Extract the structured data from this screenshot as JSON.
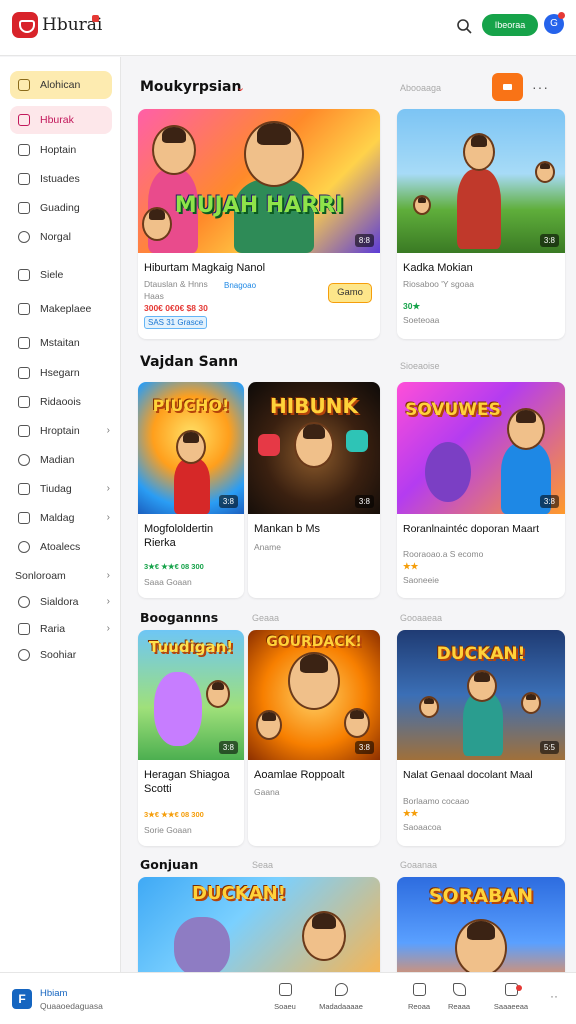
{
  "header": {
    "brand": "Hburai",
    "primary_button": "Ibeoraa",
    "avatar_letter": "G"
  },
  "sidebar": {
    "items": [
      {
        "label": "Alohican",
        "state": "active",
        "icon": "store-icon"
      },
      {
        "label": "Hburak",
        "state": "highlight",
        "icon": "grid-icon"
      },
      {
        "label": "Hoptain",
        "icon": "home-icon"
      },
      {
        "label": "Istuades",
        "icon": "calendar-icon"
      },
      {
        "label": "Guading",
        "icon": "bag-icon"
      },
      {
        "label": "Norgal",
        "icon": "globe-icon"
      },
      {
        "label": "Siele",
        "icon": "chat-icon"
      },
      {
        "label": "Makeplaee",
        "icon": "shop-icon"
      },
      {
        "label": "Mstaitan",
        "icon": "chat-icon"
      },
      {
        "label": "Hsegarn",
        "icon": "calendar-icon"
      },
      {
        "label": "Ridaoois",
        "icon": "grid-icon"
      },
      {
        "label": "Hroptain",
        "icon": "home-icon",
        "chevron": true
      },
      {
        "label": "Madian",
        "icon": "bell-icon"
      },
      {
        "label": "Tiudag",
        "icon": "calendar-icon",
        "chevron": true
      },
      {
        "label": "Maldag",
        "icon": "bag-icon",
        "chevron": true
      },
      {
        "label": "Atoalecs",
        "icon": "chat-icon"
      },
      {
        "label": "Sonloroam",
        "icon": "none",
        "chevron": true
      },
      {
        "label": "Sialdora",
        "icon": "gear-icon",
        "chevron": true
      },
      {
        "label": "Raria",
        "icon": "edit-icon",
        "chevron": true
      },
      {
        "label": "Soohiar",
        "icon": "gear-icon"
      }
    ]
  },
  "main": {
    "sections": [
      {
        "title": "Moukyrpsian",
        "link": "Abooaaga"
      },
      {
        "title": "Vajdan Sann",
        "link": "Sioeaoise"
      },
      {
        "title": "Boogannns",
        "link": "Geaaa",
        "link2": "Gooaaeaa"
      },
      {
        "title": "Gonjuan",
        "link": "Seaa",
        "link2": "Goaanaa"
      }
    ],
    "cards": [
      {
        "title": "Hiburtam Magkaig Nanol",
        "sub1": "Dtauslan & Hnns",
        "sub2": "Haas",
        "sub_link": "Bnagoao",
        "price": "300€ 0€0€ $8 30",
        "tag": "SAS 31 Grasce",
        "button": "Gamo",
        "badge": "8:8",
        "art": "MUJAH HARRI"
      },
      {
        "title": "Kadka Mokian",
        "sub1": "Riosaboo 'Y sgoaa",
        "rating": "30★",
        "sub2": "Soeteoaa",
        "badge": "3:8"
      },
      {
        "title": "Mogfololdertin Rierka",
        "rating": "3★€ ★★€ 08 300",
        "sub2": "Saaa Goaan",
        "badge": "3:8",
        "art": "PIUCHO!"
      },
      {
        "title": "Mankan b Ms",
        "sub1": "Aname",
        "badge": "3:8",
        "art": "HIBUNK"
      },
      {
        "title": "Roranlnaintéc doporan Maart",
        "sub1": "Rooraoao.a S ecomo",
        "rating": "★★",
        "sub2": "Saoneeie",
        "badge": "3:8",
        "art": "SOVUWES"
      },
      {
        "title": "Heragan Shiagoa Scotti",
        "rating": "3★€ ★★€ 08 300",
        "sub2": "Sorie Goaan",
        "badge": "3:8",
        "art": "Tuudigan!"
      },
      {
        "title": "Aoamlae Roppoalt",
        "sub1": "Gaana",
        "badge": "3:8",
        "art": "GOURDACK!"
      },
      {
        "title": "Nalat Genaal docolant Maal",
        "sub1": "Borlaamo cocaao",
        "rating": "★★",
        "sub2": "Saoaacoa",
        "badge": "5:5",
        "art": "DUCKAN!"
      },
      {
        "title": "",
        "art": "DUCKAN!"
      },
      {
        "title": "",
        "art": "SORABAN"
      }
    ]
  },
  "bottombar": {
    "app_title": "Hbiam",
    "app_sub": "Quaaoedaguasa",
    "tabs": [
      {
        "label": "Soaeu",
        "icon": "grid-icon"
      },
      {
        "label": "Madadaaaae",
        "icon": "rocket-icon"
      },
      {
        "label": "Reoaa",
        "icon": "bag-icon"
      },
      {
        "label": "Reaaa",
        "icon": "tag-icon"
      },
      {
        "label": "Saaaeeaa",
        "icon": "bell-icon"
      }
    ]
  },
  "colors": {
    "accent_green": "#16a34a",
    "accent_red": "#d8232a",
    "accent_orange": "#f97316",
    "active_item": "#fdebb0"
  }
}
